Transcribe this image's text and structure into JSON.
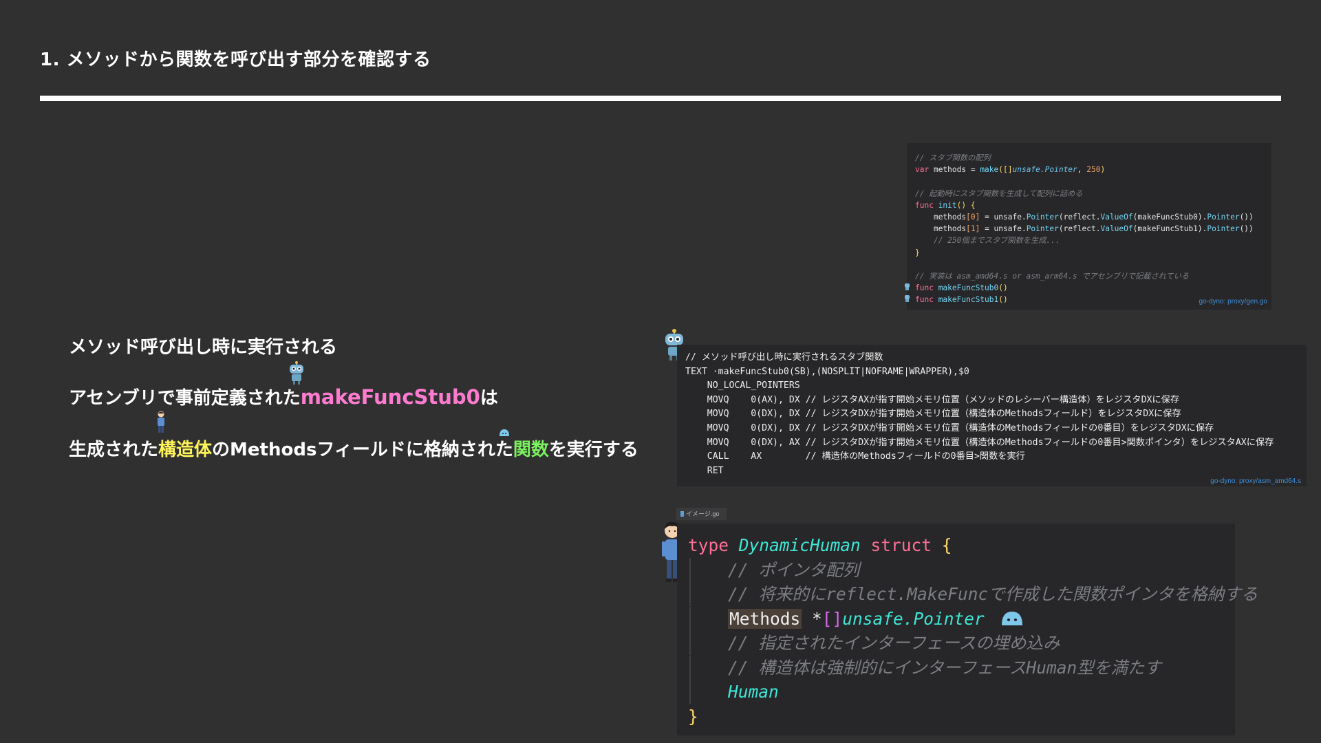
{
  "slide": {
    "title": "1. メソッドから関数を呼び出す部分を確認する"
  },
  "explanation": {
    "line1": "メソッド呼び出し時に実行される",
    "line2_prefix": "アセンブリで事前定義された",
    "line2_highlight": "makeFuncStub0",
    "line2_suffix": "は",
    "line3_prefix": "生成された",
    "line3_hl1": "構造体",
    "line3_mid": "のMethodsフィールドに格納された",
    "line3_hl2": "関数",
    "line3_suffix": "を実行する"
  },
  "code_gen": {
    "lines": {
      "c1": "// スタブ関数の配列",
      "l2_kw": "var",
      "l2_a": " methods = ",
      "l2_fn": "make",
      "l2_b": "([]",
      "l2_type": "unsafe.Pointer",
      "l2_c": ", ",
      "l2_num": "250",
      "l2_d": ")",
      "c2": "// 起動時にスタブ関数を生成して配列に詰める",
      "l4_kw": "func",
      "l4_fn": " init",
      "l4_b": "() {",
      "l5_a": "methods",
      "l5_idx": "[0]",
      "l5_b": " = unsafe.",
      "l5_fn1": "Pointer",
      "l5_c": "(reflect.",
      "l5_fn2": "ValueOf",
      "l5_d": "(makeFuncStub0).",
      "l5_fn3": "Pointer",
      "l5_e": "())",
      "l6_a": "methods",
      "l6_idx": "[1]",
      "l6_b": " = unsafe.",
      "l6_fn1": "Pointer",
      "l6_c": "(reflect.",
      "l6_fn2": "ValueOf",
      "l6_d": "(makeFuncStub1).",
      "l6_fn3": "Pointer",
      "l6_e": "())",
      "c3": "// 250個までスタブ関数を生成...",
      "l8": "}",
      "c4": "// 実装は asm_amd64.s or asm_arm64.s でアセンブリで記載されている",
      "l10_kw": "func",
      "l10_fn": " makeFuncStub0",
      "l10_b": "()",
      "l11_kw": "func",
      "l11_fn": " makeFuncStub1",
      "l11_b": "()"
    },
    "source": "go-dyno: proxy/gen.go"
  },
  "code_asm": {
    "lines": [
      "// メソッド呼び出し時に実行されるスタブ関数",
      "TEXT ·makeFuncStub0(SB),(NOSPLIT|NOFRAME|WRAPPER),$0",
      "    NO_LOCAL_POINTERS",
      "    MOVQ    0(AX), DX // レジスタAXが指す開始メモリ位置（メソッドのレシーバー構造体）をレジスタDXに保存",
      "    MOVQ    0(DX), DX // レジスタDXが指す開始メモリ位置（構造体のMethodsフィールド）をレジスタDXに保存",
      "    MOVQ    0(DX), DX // レジスタDXが指す開始メモリ位置（構造体のMethodsフィールドの0番目）をレジスタDXに保存",
      "    MOVQ    0(DX), AX // レジスタDXが指す開始メモリ位置（構造体のMethodsフィールドの0番目>関数ポインタ）をレジスタAXに保存",
      "    CALL    AX        // 構造体のMethodsフィールドの0番目>関数を実行",
      "    RET"
    ],
    "source": "go-dyno: proxy/asm_amd64.s"
  },
  "code_struct": {
    "tab": "イメージ.go",
    "l1_kw": "type ",
    "l1_name": "DynamicHuman",
    "l1_kw2": " struct ",
    "l1_br": "{",
    "c1": "// ポインタ配列",
    "c2": "// 将来的にreflect.MakeFuncで作成した関数ポインタを格納する",
    "field": "Methods",
    "star": " *",
    "brk": "[]",
    "ptr": "unsafe.Pointer",
    "c3": "// 指定されたインターフェースの埋め込み",
    "c4": "// 構造体は強制的にインターフェースHuman型を満たす",
    "embed": "Human",
    "close": "}"
  },
  "colors": {
    "background": "#303031",
    "code_bg": "#272729",
    "pink": "#ff7bd0",
    "yellow": "#fff35a",
    "green": "#7cf05f",
    "link": "#3e8ed8"
  },
  "icons": [
    "robot-icon",
    "person-icon",
    "blue-blob-icon"
  ]
}
